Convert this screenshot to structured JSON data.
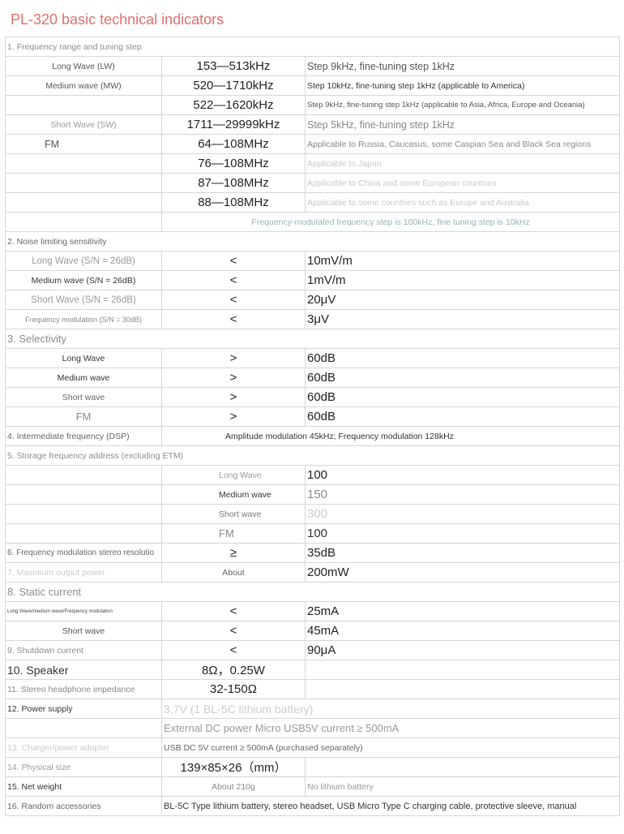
{
  "title": "PL-320 basic technical indicators",
  "rows": {
    "freq": {
      "heading": "1. Frequency range and tuning step",
      "lw": {
        "label": "Long Wave (LW)",
        "range": "153—513kHz",
        "note": "Step 9kHz, fine-tuning step 1kHz"
      },
      "mw": {
        "label": "Medium wave (MW)",
        "range": "520—1710kHz",
        "note": "Step 10kHz, fine-tuning step 1kHz (applicable to America)"
      },
      "mw2": {
        "range": "522—1620kHz",
        "note": "Step 9kHz, fine-tuning step 1kHz (applicable to Asia, Africa, Europe and Oceania)"
      },
      "sw": {
        "label": "Short Wave (SW)",
        "range": "1711—29999kHz",
        "note": "Step 5kHz, fine-tuning step 1kHz"
      },
      "fm": {
        "label": "FM",
        "range": "64—108MHz",
        "note": "Applicable to Russia, Caucasus, some Caspian Sea and Black Sea regions"
      },
      "fm2": {
        "range": "76—108MHz",
        "note": "Applicable to Japan"
      },
      "fm3": {
        "range": "87—108MHz",
        "note": "Applicable to China and some European countries"
      },
      "fm4": {
        "range": "88—108MHz",
        "note": "Applicable to some countries such as Europe and Australia"
      },
      "fm_step": "Frequency-modulated frequency step is 100kHz, fine tuning step is 10kHz"
    },
    "noise": {
      "heading": "2. Noise limiting sensitivity",
      "items": [
        {
          "label": "Long Wave (S/N = 26dB)",
          "sym": "<",
          "value": "10mV/m"
        },
        {
          "label": "Medium wave (S/N = 26dB)",
          "sym": "<",
          "value": "1mV/m"
        },
        {
          "label": "Short Wave (S/N = 26dB)",
          "sym": "<",
          "value": "20μV"
        },
        {
          "label": "Frequency modulation (S/N = 30dB)",
          "sym": "<",
          "value": "3μV"
        }
      ]
    },
    "select": {
      "heading": "3. Selectivity",
      "items": [
        {
          "label": "Long Wave",
          "sym": ">",
          "value": "60dB"
        },
        {
          "label": "Medium wave",
          "sym": ">",
          "value": "60dB"
        },
        {
          "label": "Short wave",
          "sym": ">",
          "value": "60dB"
        },
        {
          "label": "FM",
          "sym": ">",
          "value": "60dB"
        }
      ]
    },
    "if": {
      "heading": "4. Intermediate frequency (DSP)",
      "value": "Amplitude modulation 45kHz; Frequency modulation 128kHz"
    },
    "storage": {
      "heading": "5. Storage frequency address (excluding ETM)",
      "items": [
        {
          "label": "Long Wave",
          "value": "100"
        },
        {
          "label": "Medium wave",
          "value": "150"
        },
        {
          "label": "Short wave",
          "value": "300"
        },
        {
          "label": "FM",
          "value": "100"
        }
      ]
    },
    "stereo": {
      "heading": "6. Frequency modulation stereo resolutio",
      "sym": "≥",
      "value": "35dB"
    },
    "power": {
      "heading": "7. Maximum output power",
      "sym": "About",
      "value": "200mW"
    },
    "static": {
      "heading": "8. Static current",
      "items": [
        {
          "label": "Long Wave/medium wave/Frequency modulation",
          "sym": "<",
          "value": "25mA"
        },
        {
          "label": "Short wave",
          "sym": "<",
          "value": "45mA"
        }
      ]
    },
    "shutdown": {
      "heading": "9. Shutdown current",
      "sym": "<",
      "value": "90μA"
    },
    "speaker": {
      "heading": "10. Speaker",
      "value": "8Ω，0.25W"
    },
    "headphone": {
      "heading": "11. Stereo headphone impedance",
      "value": "32-150Ω"
    },
    "supply": {
      "heading": "12. Power supply",
      "value": "3.7V (1 BL-5C lithium battery)",
      "value2": "External DC power Micro USB5V current ≥ 500mA"
    },
    "charge": {
      "heading": "13. Charger/power adapter",
      "value": "USB DC 5V current ≥ 500mA (purchased separately)"
    },
    "size": {
      "heading": "14. Physical size",
      "value": "139×85×26（mm）"
    },
    "weight": {
      "heading": "15. Net weight",
      "value": "About 210g",
      "note": "No lithium battery"
    },
    "acc": {
      "heading": "16. Random accessories",
      "value": "BL-5C Type lithium battery, stereo headset, USB Micro Type C charging cable, protective sleeve, manual"
    }
  }
}
